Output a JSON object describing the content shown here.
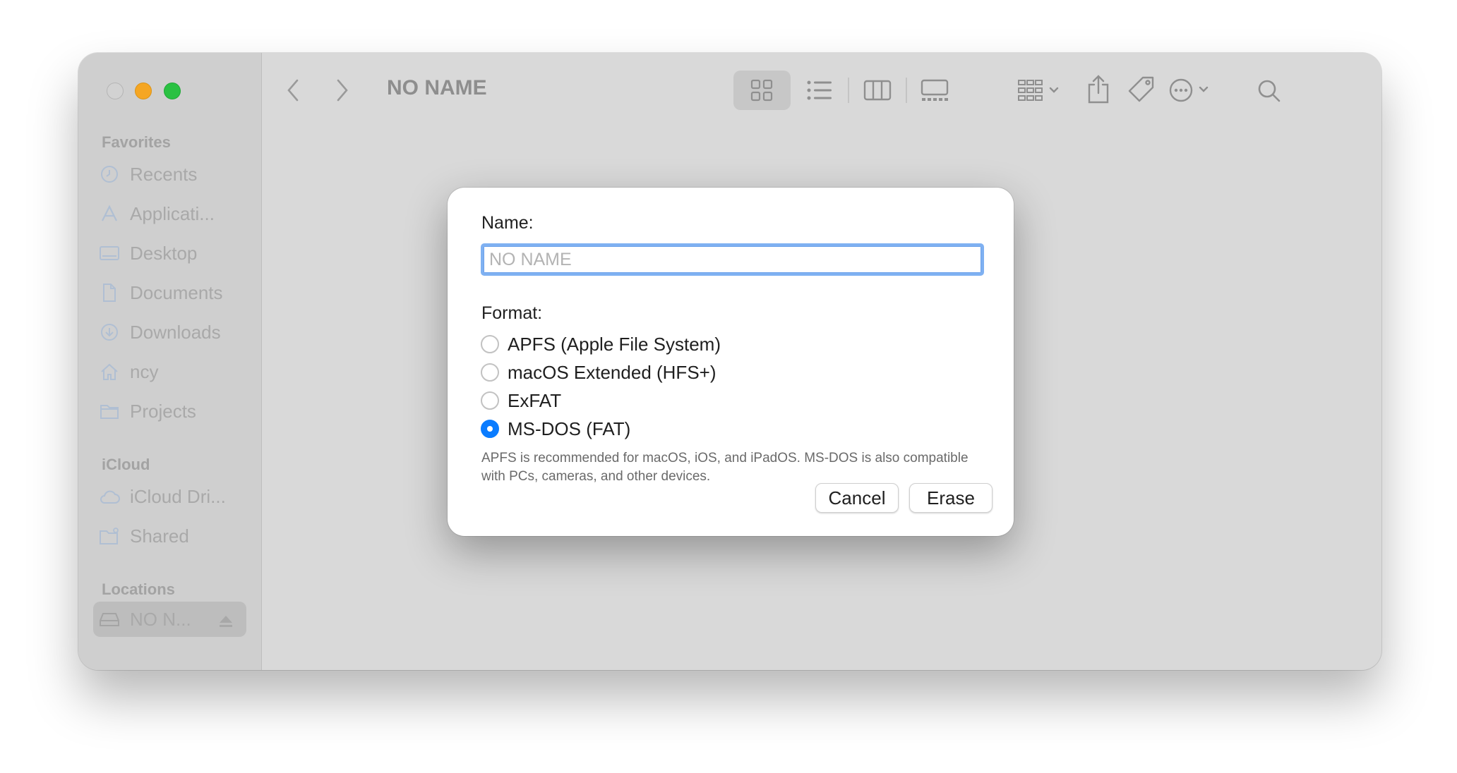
{
  "window": {
    "title": "NO NAME",
    "traffic_lights": {
      "close": "#d2d2d2",
      "minimize": "#f5a623",
      "maximize": "#2ac142"
    }
  },
  "sidebar": {
    "favorites_title": "Favorites",
    "favorites": [
      {
        "label": "Recents",
        "icon": "clock-icon"
      },
      {
        "label": "Applicati...",
        "icon": "applications-icon"
      },
      {
        "label": "Desktop",
        "icon": "desktop-icon"
      },
      {
        "label": "Documents",
        "icon": "document-icon"
      },
      {
        "label": "Downloads",
        "icon": "download-icon"
      },
      {
        "label": "ncy",
        "icon": "home-icon"
      },
      {
        "label": "Projects",
        "icon": "folder-icon"
      }
    ],
    "icloud_title": "iCloud",
    "icloud": [
      {
        "label": "iCloud Dri...",
        "icon": "cloud-icon"
      },
      {
        "label": "Shared",
        "icon": "shared-folder-icon"
      }
    ],
    "locations_title": "Locations",
    "locations": [
      {
        "label": "NO N...",
        "icon": "drive-icon",
        "selected": true
      }
    ]
  },
  "dialog": {
    "name_label": "Name:",
    "name_value": "",
    "name_placeholder": "NO NAME",
    "format_label": "Format:",
    "formats": [
      {
        "label": "APFS (Apple File System)",
        "checked": false
      },
      {
        "label": "macOS Extended (HFS+)",
        "checked": false
      },
      {
        "label": "ExFAT",
        "checked": false
      },
      {
        "label": "MS-DOS (FAT)",
        "checked": true
      }
    ],
    "help_text": "APFS is recommended for macOS, iOS, and iPadOS. MS-DOS is also compatible with PCs, cameras, and other devices.",
    "cancel_label": "Cancel",
    "erase_label": "Erase"
  },
  "colors": {
    "accent": "#0a7cff",
    "focus_ring": "#7fb1f2"
  }
}
